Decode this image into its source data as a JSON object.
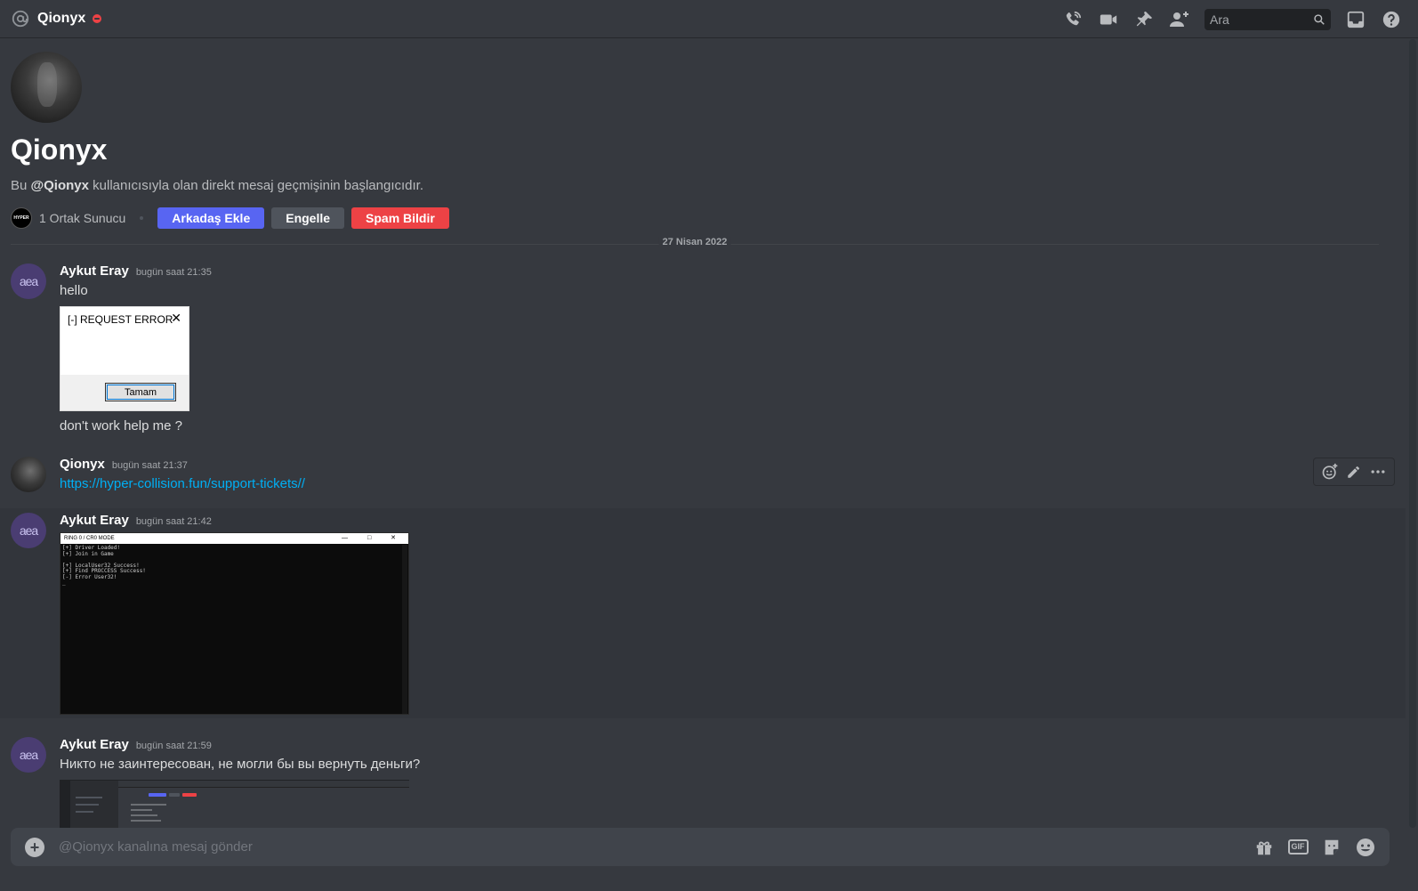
{
  "header": {
    "channel_name": "Qionyx",
    "search_placeholder": "Ara"
  },
  "welcome": {
    "name": "Qionyx",
    "intro_prefix": "Bu ",
    "intro_handle": "@Qionyx",
    "intro_suffix": " kullanıcısıyla olan direkt mesaj geçmişinin başlangıcıdır.",
    "mutual_servers": "1 Ortak Sunucu",
    "server_icon_text": "HYPER",
    "add_friend": "Arkadaş Ekle",
    "block": "Engelle",
    "report_spam": "Spam Bildir"
  },
  "date_divider": "27 Nisan 2022",
  "messages": [
    {
      "author": "Aykut Eray",
      "avatar_text": "aea",
      "timestamp": "bugün saat 21:35",
      "text": "hello",
      "attachment": {
        "title": "[-] REQUEST ERROR",
        "close": "✕",
        "button": "Tamam"
      },
      "followup": "don't work help me ?"
    },
    {
      "author": "Qionyx",
      "timestamp": "bugün saat 21:37",
      "link": "https://hyper-collision.fun/support-tickets//"
    },
    {
      "author": "Aykut Eray",
      "avatar_text": "aea",
      "timestamp": "bugün saat 21:42",
      "console": {
        "title": "RING 0 / CR0 MODE",
        "controls": "— □ ✕",
        "lines": "[+] Driver Loaded!\n[+] Join in Game\n\n[+] LocalUser32 Success!\n[+] Find PROCCESS Success!\n[-] Error User32!\n_"
      }
    },
    {
      "author": "Aykut Eray",
      "avatar_text": "aea",
      "timestamp": "bugün saat 21:59",
      "text": "Никто не заинтересован, не могли бы вы вернуть деньги?"
    }
  ],
  "composer": {
    "placeholder": "@Qionyx kanalına mesaj gönder",
    "gif_label": "GIF"
  },
  "colors": {
    "background": "#36393f",
    "blurple": "#5865f2",
    "danger": "#ed4245",
    "link": "#00aff4"
  },
  "icons": [
    "at-icon",
    "dnd-status-icon",
    "voice-call-icon",
    "video-call-icon",
    "pin-icon",
    "add-member-icon",
    "search-icon",
    "inbox-icon",
    "help-icon",
    "add-reaction-icon",
    "edit-icon",
    "more-icon",
    "plus-icon",
    "gift-icon",
    "gif-icon",
    "sticker-icon",
    "emoji-icon"
  ]
}
